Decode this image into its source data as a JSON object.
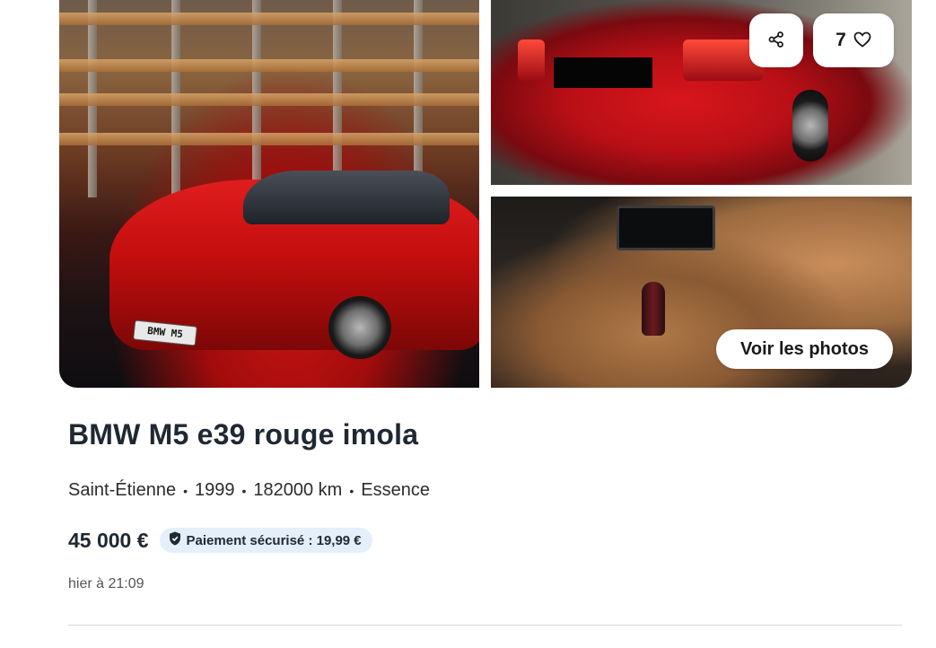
{
  "gallery": {
    "main_plate_text": "BMW M5",
    "share_icon": "share-icon",
    "favorite_icon": "heart-icon",
    "favorite_count": "7",
    "see_photos_label": "Voir les photos"
  },
  "listing": {
    "title": "BMW M5 e39 rouge imola",
    "location": "Saint-Étienne",
    "year": "1999",
    "mileage": "182000 km",
    "fuel": "Essence",
    "separator": "•",
    "price": "45 000 €",
    "secure_payment_badge": "Paiement sécurisé : 19,99 €",
    "badge_icon": "shield-icon",
    "posted_at": "hier à 21:09"
  },
  "colors": {
    "badge_bg": "#e4effa",
    "title_text": "#1f2833",
    "car_red": "#d8161c"
  }
}
